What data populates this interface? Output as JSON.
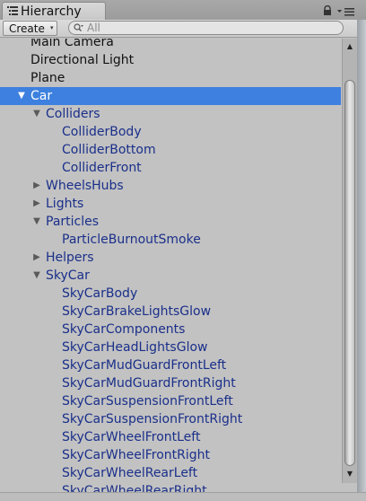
{
  "window": {
    "tab_title": "Hierarchy",
    "tab_icon": "hierarchy-list-icon",
    "lock_icon": "lock-icon",
    "menu_icon": "panel-menu-icon"
  },
  "toolbar": {
    "create_label": "Create",
    "create_arrow": "▾",
    "search_placeholder": "All",
    "search_value": ""
  },
  "tree": {
    "rows": [
      {
        "label": "Main Camera",
        "depth": 0,
        "toggle": "",
        "color": "black",
        "selected": false
      },
      {
        "label": "Directional Light",
        "depth": 0,
        "toggle": "",
        "color": "black",
        "selected": false
      },
      {
        "label": "Plane",
        "depth": 0,
        "toggle": "",
        "color": "black",
        "selected": false
      },
      {
        "label": "Car",
        "depth": 0,
        "toggle": "▼",
        "color": "blue",
        "selected": true
      },
      {
        "label": "Colliders",
        "depth": 1,
        "toggle": "▼",
        "color": "blue",
        "selected": false
      },
      {
        "label": "ColliderBody",
        "depth": 2,
        "toggle": "",
        "color": "blue",
        "selected": false
      },
      {
        "label": "ColliderBottom",
        "depth": 2,
        "toggle": "",
        "color": "blue",
        "selected": false
      },
      {
        "label": "ColliderFront",
        "depth": 2,
        "toggle": "",
        "color": "blue",
        "selected": false
      },
      {
        "label": "WheelsHubs",
        "depth": 1,
        "toggle": "▶",
        "color": "blue",
        "selected": false
      },
      {
        "label": "Lights",
        "depth": 1,
        "toggle": "▶",
        "color": "blue",
        "selected": false
      },
      {
        "label": "Particles",
        "depth": 1,
        "toggle": "▼",
        "color": "blue",
        "selected": false
      },
      {
        "label": "ParticleBurnoutSmoke",
        "depth": 2,
        "toggle": "",
        "color": "blue",
        "selected": false
      },
      {
        "label": "Helpers",
        "depth": 1,
        "toggle": "▶",
        "color": "blue",
        "selected": false
      },
      {
        "label": "SkyCar",
        "depth": 1,
        "toggle": "▼",
        "color": "blue",
        "selected": false
      },
      {
        "label": "SkyCarBody",
        "depth": 2,
        "toggle": "",
        "color": "blue",
        "selected": false
      },
      {
        "label": "SkyCarBrakeLightsGlow",
        "depth": 2,
        "toggle": "",
        "color": "blue",
        "selected": false
      },
      {
        "label": "SkyCarComponents",
        "depth": 2,
        "toggle": "",
        "color": "blue",
        "selected": false
      },
      {
        "label": "SkyCarHeadLightsGlow",
        "depth": 2,
        "toggle": "",
        "color": "blue",
        "selected": false
      },
      {
        "label": "SkyCarMudGuardFrontLeft",
        "depth": 2,
        "toggle": "",
        "color": "blue",
        "selected": false
      },
      {
        "label": "SkyCarMudGuardFrontRight",
        "depth": 2,
        "toggle": "",
        "color": "blue",
        "selected": false
      },
      {
        "label": "SkyCarSuspensionFrontLeft",
        "depth": 2,
        "toggle": "",
        "color": "blue",
        "selected": false
      },
      {
        "label": "SkyCarSuspensionFrontRight",
        "depth": 2,
        "toggle": "",
        "color": "blue",
        "selected": false
      },
      {
        "label": "SkyCarWheelFrontLeft",
        "depth": 2,
        "toggle": "",
        "color": "blue",
        "selected": false
      },
      {
        "label": "SkyCarWheelFrontRight",
        "depth": 2,
        "toggle": "",
        "color": "blue",
        "selected": false
      },
      {
        "label": "SkyCarWheelRearLeft",
        "depth": 2,
        "toggle": "",
        "color": "blue",
        "selected": false
      },
      {
        "label": "SkyCarWheelRearRight",
        "depth": 2,
        "toggle": "",
        "color": "blue",
        "selected": false
      }
    ]
  },
  "scrollbar": {
    "up_arrow": "▲",
    "down_arrow": "▼",
    "scroll_position": 0.02
  },
  "colors": {
    "selection": "#3d80df",
    "object_blue": "#1a2f8a",
    "object_black": "#111111",
    "panel_bg": "#c2c2c2"
  }
}
